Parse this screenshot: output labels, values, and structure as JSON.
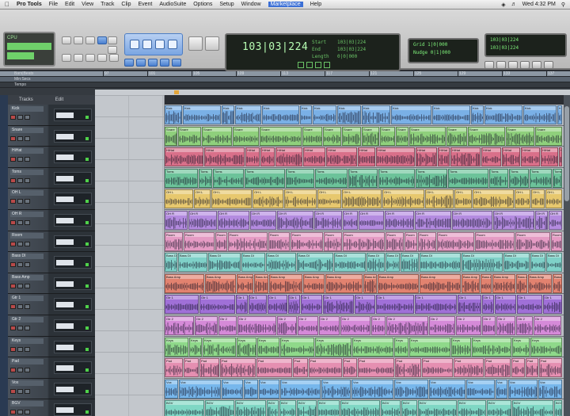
{
  "menubar": {
    "app_name": "Pro Tools",
    "items": [
      "File",
      "Edit",
      "View",
      "Track",
      "Clip",
      "Event",
      "AudioSuite",
      "Options",
      "Setup",
      "Window",
      "Marketplace",
      "Help"
    ],
    "highlighted_index": 10,
    "clock": "Wed 4:32 PM"
  },
  "counter": {
    "main_counter": "103|03|224",
    "start": "103|03|224",
    "end": "103|03|224",
    "length": "0|0|000"
  },
  "grid": {
    "label": "Grid",
    "value": "1|0|000",
    "nudge_label": "Nudge",
    "nudge_value": "0|1|000"
  },
  "selection": {
    "start_label": "Start",
    "end_label": "End",
    "length_label": "Length"
  },
  "rulers": {
    "rows": [
      "Bars|Beats",
      "Min:Secs",
      "Tempo",
      "Meter",
      "Markers"
    ],
    "bar_ticks": [
      "97",
      "101",
      "105",
      "109",
      "113",
      "117",
      "121",
      "125",
      "129",
      "133",
      "137"
    ]
  },
  "track_panel_header": [
    "Tracks",
    "Edit"
  ],
  "tracks": [
    {
      "name": "Kick",
      "color": "#7ab0e6"
    },
    {
      "name": "Snare",
      "color": "#8fd07c"
    },
    {
      "name": "HiHat",
      "color": "#d9708a"
    },
    {
      "name": "Toms",
      "color": "#6cc39a"
    },
    {
      "name": "OH L",
      "color": "#e7c86e"
    },
    {
      "name": "OH R",
      "color": "#b48be0"
    },
    {
      "name": "Room",
      "color": "#e59bc4"
    },
    {
      "name": "Bass DI",
      "color": "#7fd1c8"
    },
    {
      "name": "Bass Amp",
      "color": "#e2826f"
    },
    {
      "name": "Gtr 1",
      "color": "#a070d8"
    },
    {
      "name": "Gtr 2",
      "color": "#d58ad8"
    },
    {
      "name": "Keys",
      "color": "#8fd98a"
    },
    {
      "name": "Pad",
      "color": "#e58fb1"
    },
    {
      "name": "Vox",
      "color": "#77b7ec"
    },
    {
      "name": "BGV",
      "color": "#7fd7c4"
    }
  ],
  "ui_colors": {
    "counter_green": "#7ef07a",
    "tool_blue": "#7aa5e2",
    "marker_orange": "#e3a53a"
  }
}
